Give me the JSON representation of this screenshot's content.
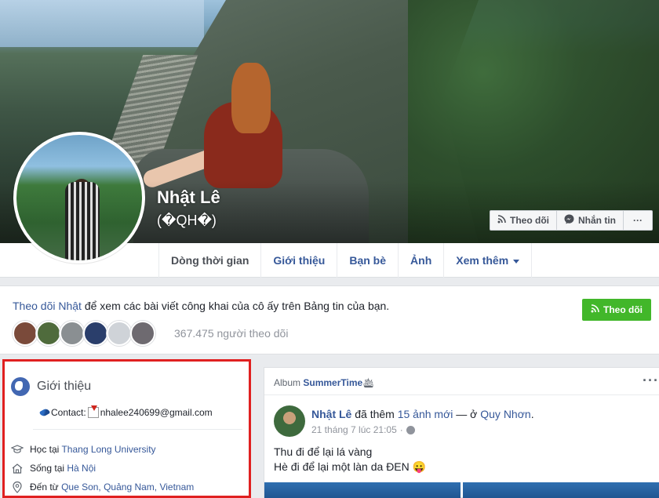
{
  "profile": {
    "name": "Nhật Lê",
    "alt_name": "(�QH�)"
  },
  "cover_actions": {
    "follow": "Theo dõi",
    "message": "Nhắn tin",
    "more": "···"
  },
  "tabs": [
    {
      "label": "Dòng thời gian",
      "active": true
    },
    {
      "label": "Giới thiệu"
    },
    {
      "label": "Bạn bè"
    },
    {
      "label": "Ảnh"
    },
    {
      "label": "Xem thêm"
    }
  ],
  "follow_box": {
    "link_text": "Theo dõi Nhật",
    "rest_text": " để xem các bài viết công khai của cô ấy trên Bảng tin của bạn.",
    "button_label": "Theo dõi",
    "followers_text": "367.475 người theo dõi",
    "avatar_colors": [
      "#7a4a3a",
      "#4f6b3c",
      "#8a8f92",
      "#2a3e6b",
      "#cfd3d8",
      "#6e6a70"
    ]
  },
  "intro": {
    "title": "Giới thiệu",
    "contact_label": "Contact:",
    "contact_email": "nhalee240699@gmail.com",
    "study_prefix": "Học tại ",
    "study_place": "Thang Long University",
    "live_prefix": "Sống tại ",
    "live_place": "Hà Nội",
    "from_prefix": "Đến từ ",
    "from_place": "Que Son, Quảng Nam, Vietnam"
  },
  "post": {
    "album_prefix": "Album ",
    "album_name": "SummerTime",
    "album_emoji": "🛳",
    "more": "···",
    "author": "Nhật Lê",
    "action_prefix": " đã thêm ",
    "photos_count": "15 ảnh mới",
    "location_prefix": " — ở ",
    "location": "Quy Nhơn",
    "location_suffix": ".",
    "timestamp": "21 tháng 7 lúc 21:05",
    "line1": "Thu đi để lại lá vàng",
    "line2": "Hè đi để lại một làn da ĐEN 😛"
  },
  "colors": {
    "link": "#365899",
    "follow_green": "#42b72a",
    "highlight_border": "#e02020"
  }
}
